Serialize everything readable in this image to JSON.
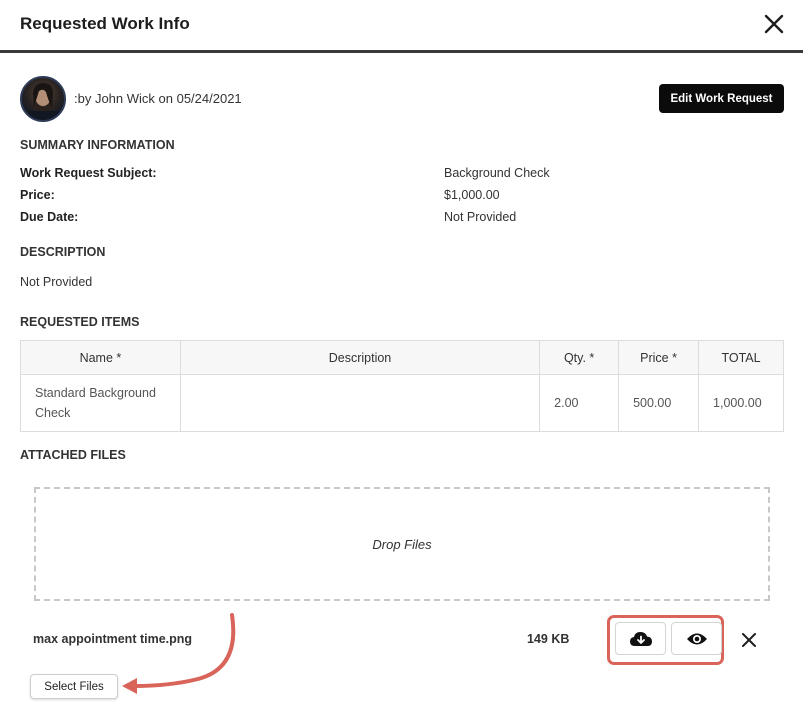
{
  "header": {
    "title": "Requested Work Info"
  },
  "request": {
    "byline": ":by John Wick on 05/24/2021",
    "edit_label": "Edit Work Request"
  },
  "summary": {
    "heading": "SUMMARY INFORMATION",
    "rows": [
      {
        "label": "Work Request Subject:",
        "value": "Background Check"
      },
      {
        "label": "Price:",
        "value": "$1,000.00"
      },
      {
        "label": "Due Date:",
        "value": "Not Provided"
      }
    ]
  },
  "description": {
    "heading": "DESCRIPTION",
    "value": "Not Provided"
  },
  "items": {
    "heading": "REQUESTED ITEMS",
    "columns": [
      "Name *",
      "Description",
      "Qty. *",
      "Price *",
      "TOTAL"
    ],
    "rows": [
      {
        "name": "Standard Background Check",
        "description": "",
        "qty": "2.00",
        "price": "500.00",
        "total": "1,000.00"
      }
    ]
  },
  "files": {
    "heading": "ATTACHED FILES",
    "drop_label": "Drop Files",
    "list": [
      {
        "name": "max appointment time.png",
        "size": "149 KB"
      }
    ],
    "select_label": "Select Files"
  },
  "icons": {
    "close": "close-icon",
    "download": "cloud-download-icon",
    "view": "eye-icon",
    "remove": "close-icon"
  },
  "colors": {
    "annotation": "#d9655a",
    "primary_button": "#0b0b0b"
  }
}
